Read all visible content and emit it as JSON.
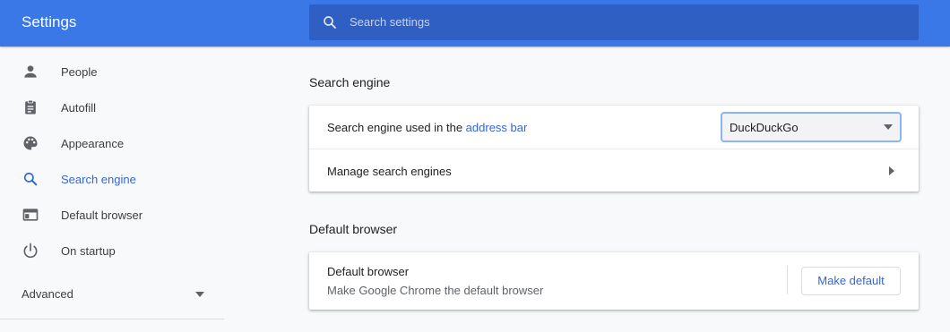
{
  "header": {
    "title": "Settings",
    "search_placeholder": "Search settings",
    "search_icon": "search-icon"
  },
  "sidebar": {
    "items": [
      {
        "label": "People",
        "icon": "person-icon"
      },
      {
        "label": "Autofill",
        "icon": "clipboard-icon"
      },
      {
        "label": "Appearance",
        "icon": "palette-icon"
      },
      {
        "label": "Search engine",
        "icon": "search-icon",
        "active": true
      },
      {
        "label": "Default browser",
        "icon": "browser-window-icon"
      },
      {
        "label": "On startup",
        "icon": "power-icon"
      }
    ],
    "advanced_label": "Advanced"
  },
  "search_engine": {
    "title": "Search engine",
    "used_in_label": "Search engine used in the ",
    "address_bar_link": "address bar",
    "selected_engine": "DuckDuckGo",
    "manage_label": "Manage search engines"
  },
  "default_browser": {
    "title": "Default browser",
    "row_title": "Default browser",
    "row_subtitle": "Make Google Chrome the default browser",
    "button_label": "Make default"
  },
  "colors": {
    "header": "#3b78e7",
    "search_box": "#2f5fc2",
    "accent": "#3367d6",
    "background": "#f8f9fa"
  }
}
